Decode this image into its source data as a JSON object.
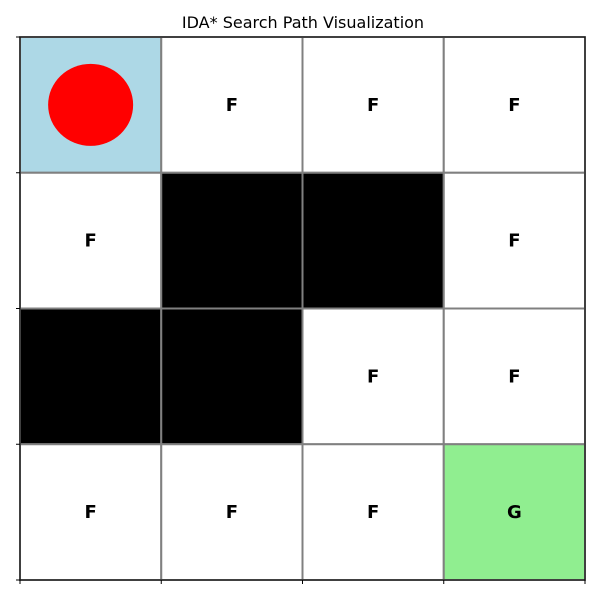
{
  "chart_data": {
    "type": "heatmap",
    "title": "IDA* Search Path Visualization",
    "rows": 4,
    "cols": 4,
    "grid": [
      [
        "start",
        "F",
        "F",
        "F"
      ],
      [
        "F",
        "wall",
        "wall",
        "F"
      ],
      [
        "wall",
        "wall",
        "F",
        "F"
      ],
      [
        "F",
        "F",
        "F",
        "G"
      ]
    ],
    "agent_position": [
      0,
      0
    ],
    "agent_marker": "red-circle",
    "goal_position": [
      3,
      3
    ],
    "x_tick_labels": [
      "",
      "",
      "",
      "",
      ""
    ],
    "y_tick_labels": [
      "",
      "",
      "",
      "",
      ""
    ],
    "colors": {
      "start": "#add8e6",
      "free": "#ffffff",
      "wall": "#000000",
      "goal": "#90ee90",
      "agent": "#ff0000",
      "gridline": "#808080",
      "label": "#000000"
    }
  }
}
